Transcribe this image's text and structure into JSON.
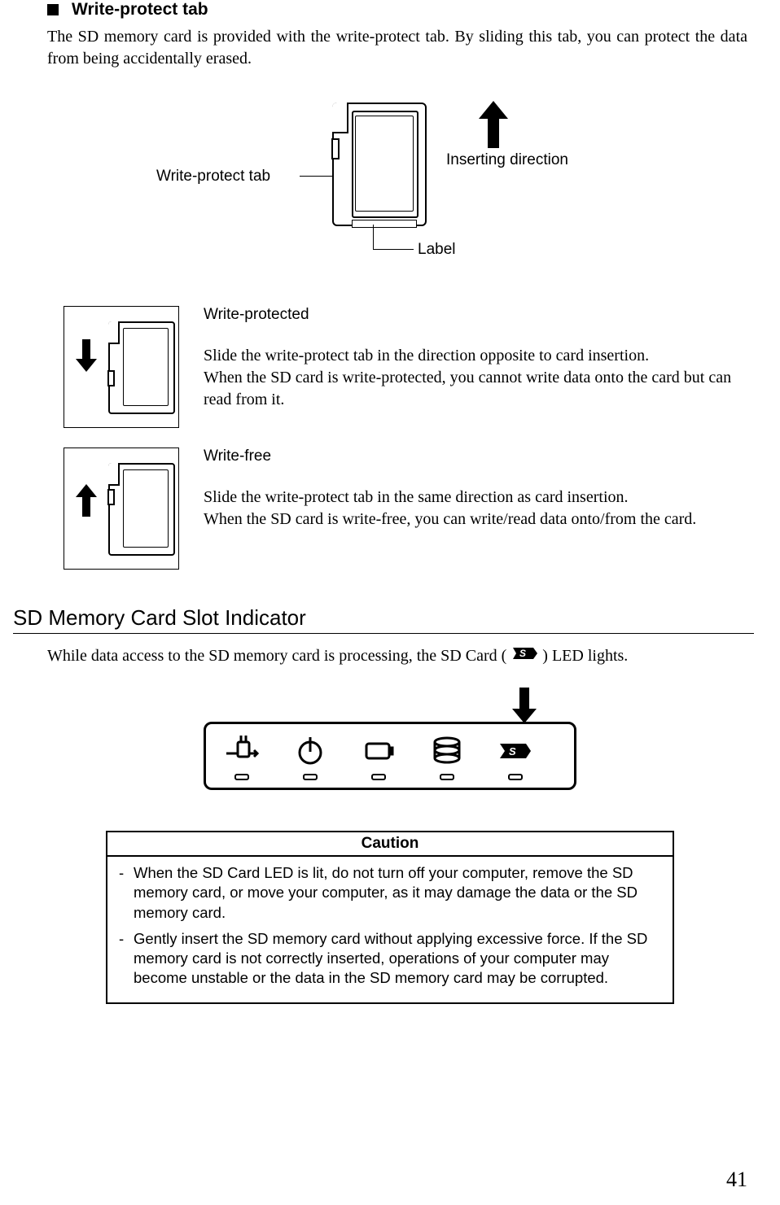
{
  "section1": {
    "title": "Write-protect tab",
    "intro": "The SD memory card is provided with the write-protect tab. By sliding this tab, you can protect the data from being accidentally erased."
  },
  "diagram": {
    "label_tab": "Write-protect tab",
    "label_direction": "Inserting direction",
    "label_label": "Label"
  },
  "protected": {
    "title": "Write-protected",
    "line1": "Slide the write-protect tab in the direction opposite to card insertion.",
    "line2": "When the SD card is write-protected, you cannot write data onto the card but can read from it."
  },
  "free": {
    "title": "Write-free",
    "line1": "Slide the write-protect tab in the same direction as card insertion.",
    "line2": "When the SD card is write-free, you can write/read data onto/from the card."
  },
  "section2": {
    "heading": "SD Memory Card Slot Indicator",
    "body_pre": "While data access to the SD memory card is processing, the SD Card (",
    "body_post": ") LED lights.",
    "sd_glyph": "S"
  },
  "caution": {
    "header": "Caution",
    "item1": "When the SD Card LED is lit, do not turn off your computer, remove the SD memory card, or move your computer, as it may damage the data or the SD memory card.",
    "item2": "Gently insert the SD memory card without applying excessive force. If the SD memory card is not correctly inserted, operations of your computer may become unstable or the data in the SD memory card may be corrupted."
  },
  "page_number": "41"
}
